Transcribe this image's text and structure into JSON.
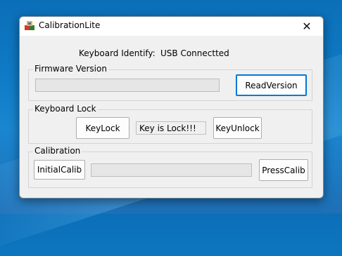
{
  "window": {
    "title": "CalibrationLite"
  },
  "identify": {
    "label": "Keyboard Identify:",
    "status": "USB Connectted"
  },
  "firmware": {
    "group_label": "Firmware Version",
    "read_button": "ReadVersion",
    "progress": 0
  },
  "lock": {
    "group_label": "Keyboard Lock",
    "lock_button": "KeyLock",
    "status": "Key is Lock!!!",
    "unlock_button": "KeyUnlock"
  },
  "calibration": {
    "group_label": "Calibration",
    "initial_button": "InitialCalib",
    "press_button": "PressCalib",
    "progress": 0
  },
  "icons": {
    "app": "app-cube-icon",
    "close": "close-icon"
  }
}
